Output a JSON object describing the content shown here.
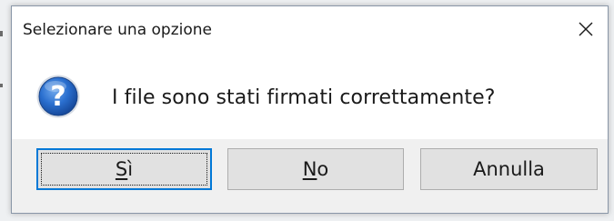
{
  "dialog": {
    "title": "Selezionare una opzione",
    "message": "I file sono stati firmati correttamente?",
    "icon": "question-icon",
    "buttons": [
      {
        "id": "yes",
        "label_mnemonic": "S",
        "label_rest": "ì",
        "default": true
      },
      {
        "id": "no",
        "label_mnemonic": "N",
        "label_rest": "o",
        "default": false
      },
      {
        "id": "cancel",
        "label": "Annulla",
        "default": false
      }
    ]
  },
  "colors": {
    "accent": "#0078d7",
    "button_bg": "#e1e1e1",
    "buttonbar_bg": "#f0f0f0",
    "icon_blue": "#1f5fb6"
  }
}
